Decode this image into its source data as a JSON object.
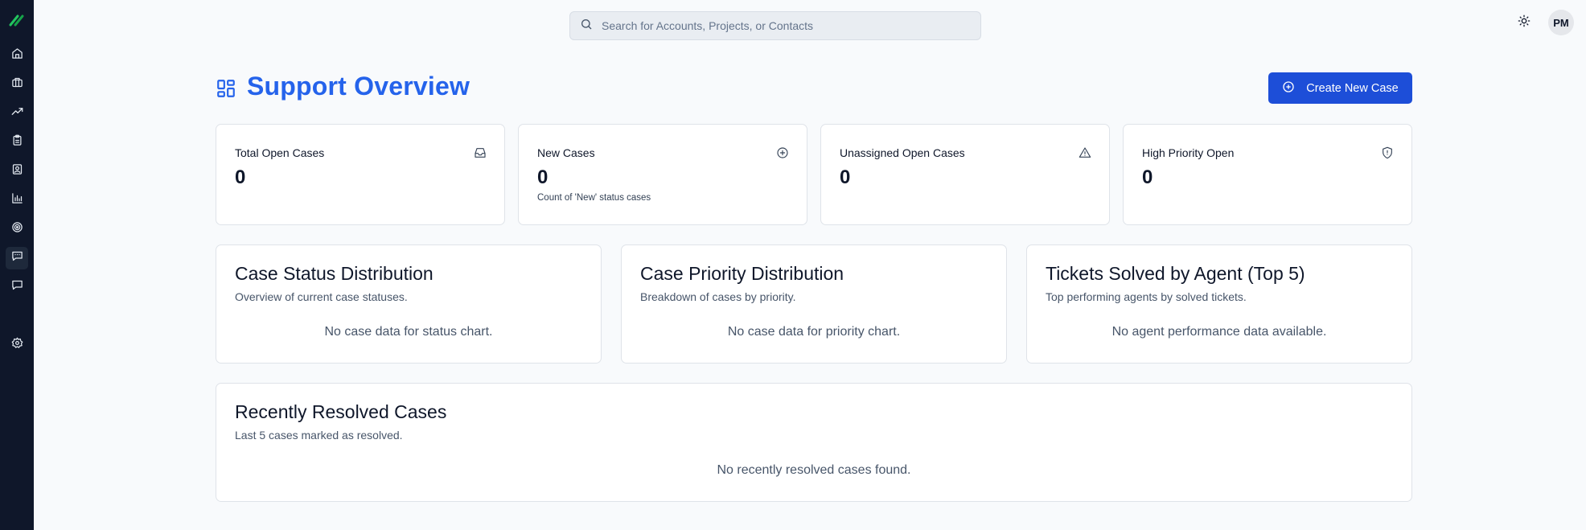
{
  "sidebar": {
    "items": [
      {
        "icon": "home-icon"
      },
      {
        "icon": "briefcase-icon"
      },
      {
        "icon": "trending-up-icon"
      },
      {
        "icon": "clipboard-icon"
      },
      {
        "icon": "contact-icon"
      },
      {
        "icon": "bar-chart-icon"
      },
      {
        "icon": "target-icon"
      },
      {
        "icon": "support-message-icon",
        "active": true
      },
      {
        "icon": "message-icon"
      },
      {
        "icon": "settings-icon"
      }
    ]
  },
  "topbar": {
    "search_placeholder": "Search for Accounts, Projects, or Contacts",
    "avatar_initials": "PM"
  },
  "header": {
    "title": "Support Overview",
    "create_button": "Create New Case"
  },
  "stats": [
    {
      "label": "Total Open Cases",
      "value": "0",
      "sub": "",
      "icon": "inbox-icon"
    },
    {
      "label": "New Cases",
      "value": "0",
      "sub": "Count of 'New' status cases",
      "icon": "plus-circle-icon"
    },
    {
      "label": "Unassigned Open Cases",
      "value": "0",
      "sub": "",
      "icon": "alert-triangle-icon"
    },
    {
      "label": "High Priority Open",
      "value": "0",
      "sub": "",
      "icon": "shield-alert-icon"
    }
  ],
  "panels": [
    {
      "title": "Case Status Distribution",
      "subtitle": "Overview of current case statuses.",
      "empty": "No case data for status chart."
    },
    {
      "title": "Case Priority Distribution",
      "subtitle": "Breakdown of cases by priority.",
      "empty": "No case data for priority chart."
    },
    {
      "title": "Tickets Solved by Agent (Top 5)",
      "subtitle": "Top performing agents by solved tickets.",
      "empty": "No agent performance data available."
    }
  ],
  "resolved": {
    "title": "Recently Resolved Cases",
    "subtitle": "Last 5 cases marked as resolved.",
    "empty": "No recently resolved cases found."
  },
  "colors": {
    "sidebar_bg": "#0f172a",
    "accent": "#2563eb",
    "button_bg": "#1d4ed8",
    "logo_green": "#22c55e"
  }
}
